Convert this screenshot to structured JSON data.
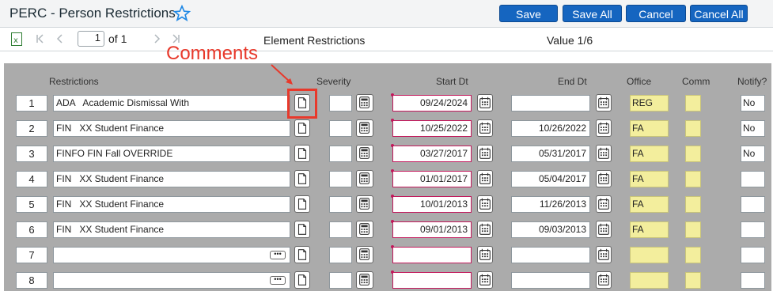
{
  "header": {
    "title": "PERC - Person Restrictions",
    "buttons": {
      "save": "Save",
      "save_all": "Save All",
      "cancel": "Cancel",
      "cancel_all": "Cancel All"
    }
  },
  "toolbar": {
    "page_value": "1",
    "page_of": "of 1",
    "element_title": "Element Restrictions",
    "value_title": "Value 1/6"
  },
  "annotation": {
    "text": "Comments"
  },
  "columns": {
    "restrictions": "Restrictions",
    "severity": "Severity",
    "start_dt": "Start Dt",
    "end_dt": "End Dt",
    "office": "Office",
    "comm": "Comm",
    "notify": "Notify?"
  },
  "rows": [
    {
      "num": "1",
      "restriction": "ADA   Academic Dismissal With",
      "start": "09/24/2024",
      "end": "",
      "office": "REG",
      "notify": "No"
    },
    {
      "num": "2",
      "restriction": "FIN   XX Student Finance",
      "start": "10/25/2022",
      "end": "10/26/2022",
      "office": "FA",
      "notify": "No"
    },
    {
      "num": "3",
      "restriction": "FINFO FIN Fall OVERRIDE",
      "start": "03/27/2017",
      "end": "05/31/2017",
      "office": "FA",
      "notify": "No"
    },
    {
      "num": "4",
      "restriction": "FIN   XX Student Finance",
      "start": "01/01/2017",
      "end": "05/04/2017",
      "office": "FA",
      "notify": ""
    },
    {
      "num": "5",
      "restriction": "FIN   XX Student Finance",
      "start": "10/01/2013",
      "end": "11/26/2013",
      "office": "FA",
      "notify": ""
    },
    {
      "num": "6",
      "restriction": "FIN   XX Student Finance",
      "start": "09/01/2013",
      "end": "09/03/2013",
      "office": "FA",
      "notify": ""
    },
    {
      "num": "7",
      "restriction": "",
      "start": "",
      "end": "",
      "office": "",
      "notify": ""
    },
    {
      "num": "8",
      "restriction": "",
      "start": "",
      "end": "",
      "office": "",
      "notify": ""
    }
  ],
  "more_glyph": "•••",
  "colors": {
    "primary_button": "#1565c0",
    "required_border": "#c2185b",
    "readonly_fill": "#f3ee9d",
    "annotation": "#e8392b"
  }
}
